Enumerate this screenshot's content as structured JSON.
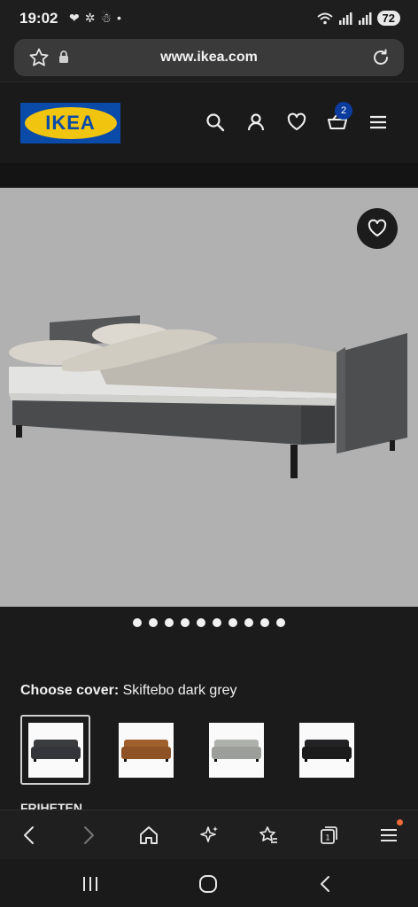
{
  "status_bar": {
    "time": "19:02",
    "battery": "72",
    "left_icons": [
      "heart-icon",
      "sync-icon",
      "snowman-icon",
      "dot-icon"
    ],
    "right_icons": [
      "wifi-icon",
      "signal-icon",
      "signal-icon",
      "battery-icon"
    ]
  },
  "browser": {
    "url": "www.ikea.com"
  },
  "header": {
    "logo_text": "IKEA",
    "cart_count": "2",
    "icons": [
      "search-icon",
      "account-icon",
      "favourites-icon",
      "cart-icon",
      "menu-icon"
    ]
  },
  "product": {
    "image_dots": 10,
    "choose_label": "Choose cover:",
    "choose_value": "Skiftebo dark grey",
    "swatches": [
      {
        "name": "dark grey",
        "color": "#3a3b3d"
      },
      {
        "name": "brown",
        "color": "#9a5a2b"
      },
      {
        "name": "light grey",
        "color": "#a8aaa6"
      },
      {
        "name": "black",
        "color": "#1f1f20"
      }
    ],
    "cut_title": "FRIHETEN"
  },
  "colors": {
    "background": "#1b1b1b",
    "image_bg": "#b1b1b1",
    "accent_blue": "#0a4aa8",
    "accent_yellow": "#f1c40f",
    "notify": "#f06a3a"
  }
}
